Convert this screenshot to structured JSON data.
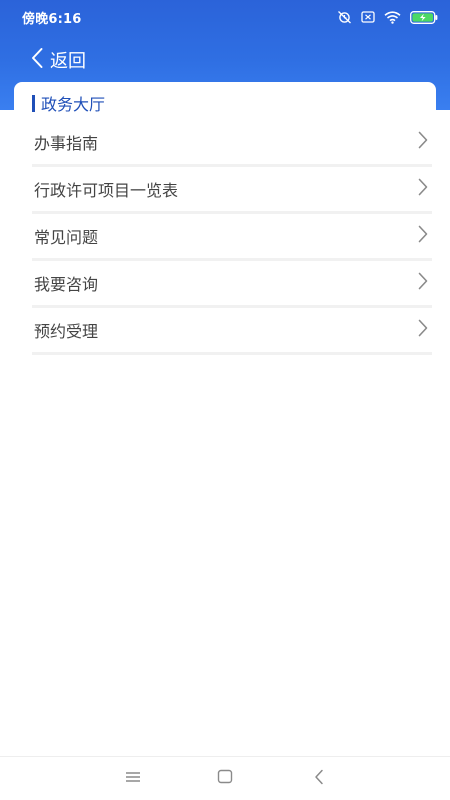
{
  "status_bar": {
    "time": "傍晚6:16",
    "icons": [
      "alarm-off-icon",
      "sim-no-signal-icon",
      "wifi-icon",
      "battery-charging-icon"
    ]
  },
  "nav": {
    "back_label": "返回",
    "back_icon": "chevron-left-icon"
  },
  "section": {
    "title": "政务大厅"
  },
  "menu": {
    "items": [
      {
        "label": "办事指南"
      },
      {
        "label": "行政许可项目一览表"
      },
      {
        "label": "常见问题"
      },
      {
        "label": "我要咨询"
      },
      {
        "label": "预约受理"
      }
    ]
  },
  "system_nav": {
    "icons": [
      "menu-icon",
      "home-icon",
      "back-icon"
    ]
  },
  "colors": {
    "header": "#2f6fe3",
    "accent": "#1f4fb8",
    "divider": "#f1f1f1",
    "text": "#444444"
  }
}
